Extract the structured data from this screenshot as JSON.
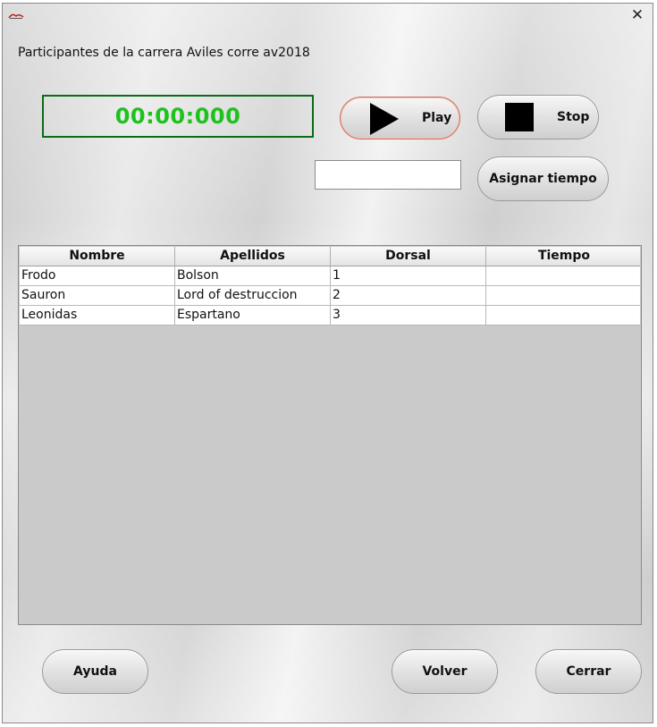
{
  "window": {
    "close_symbol": "✕"
  },
  "heading": "Participantes de la carrera Aviles corre av2018",
  "timer": {
    "value": "00:00:000",
    "color": "#1dc21d"
  },
  "controls": {
    "play_label": "Play",
    "stop_label": "Stop",
    "time_input_value": "",
    "assign_label": "Asignar tiempo"
  },
  "table": {
    "columns": [
      "Nombre",
      "Apellidos",
      "Dorsal",
      "Tiempo"
    ],
    "rows": [
      [
        "Frodo",
        "Bolson",
        "1",
        ""
      ],
      [
        "Sauron",
        "Lord of destruccion",
        "2",
        ""
      ],
      [
        "Leonidas",
        "Espartano",
        "3",
        ""
      ]
    ]
  },
  "footer": {
    "help_label": "Ayuda",
    "back_label": "Volver",
    "close_label": "Cerrar"
  },
  "icons": {
    "app": "app-logo-icon",
    "close": "close-icon",
    "play": "play-icon",
    "stop": "stop-icon"
  }
}
